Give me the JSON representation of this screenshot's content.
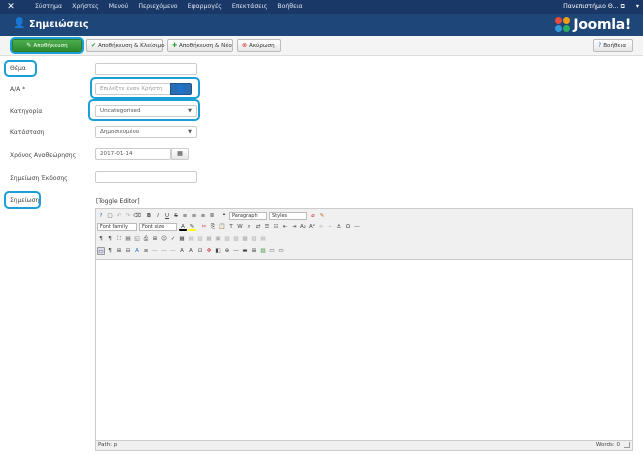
{
  "topbar": {
    "menu": [
      "Σύστημα",
      "Χρήστες",
      "Μενού",
      "Περιεχόμενο",
      "Εφαρμογές",
      "Επεκτάσεις",
      "Βοήθεια"
    ],
    "site_name": "Πανεπιστήμιο Θ...",
    "site_icon": "external-link-icon",
    "user_icon": "user-icon"
  },
  "header": {
    "title": "Σημειώσεις",
    "brand": "Joomla!",
    "title_icon": "user-icon"
  },
  "toolbar": {
    "save": "Αποθήκευση",
    "save_close": "Αποθήκευση & Κλείσιμο",
    "save_new": "Αποθήκευση & Νέο",
    "cancel": "Ακύρωση",
    "help": "Βοήθεια"
  },
  "form": {
    "subject": {
      "label": "Θέμα",
      "value": ""
    },
    "user": {
      "label": "Α/Α *",
      "placeholder": "Επιλέξτε έναν Χρήστη"
    },
    "category": {
      "label": "Κατηγορία",
      "value": "Uncategorised"
    },
    "status": {
      "label": "Κατάσταση",
      "value": "Δημοσιευμένο"
    },
    "review_time": {
      "label": "Χρόνος Αναθεώρησης",
      "value": "2017-01-14"
    },
    "version_note": {
      "label": "Σημείωση Έκδοσης",
      "value": ""
    },
    "note": {
      "label": "Σημείωση"
    }
  },
  "editor": {
    "toggle": "[Toggle Editor]",
    "format_select": "Paragraph",
    "styles_select": "Styles",
    "font_family": "Font family",
    "font_size": "Font size",
    "path": "Path:",
    "path_value": "p",
    "words": "Words: 0"
  },
  "colors": {
    "topbar": "#1a3867",
    "header": "#1e4679",
    "save_button": "#3c9c3c",
    "highlight": "#1a9fd6"
  }
}
